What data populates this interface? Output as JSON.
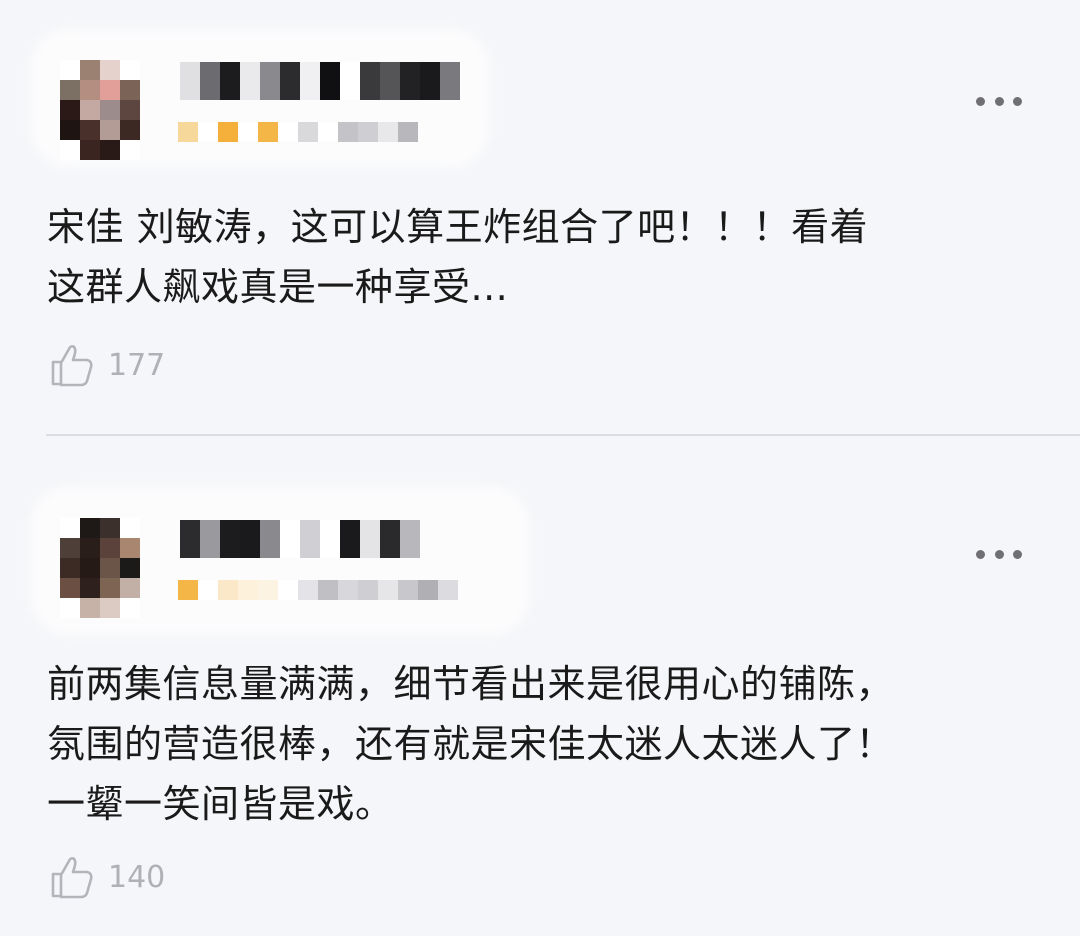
{
  "comments": [
    {
      "text_lines": [
        "宋佳 刘敏涛，这可以算王炸组合了吧！！！看着",
        "这群人飙戏真是一种享受..."
      ],
      "likes": "177",
      "avatar_colors": [
        "#ffffff",
        "#9a8171",
        "#e6d2cc",
        "#ffffff",
        "#7c6f64",
        "#b48e80",
        "#e29e99",
        "#7b6358",
        "#2a1916",
        "#c3a9a2",
        "#9c8c8c",
        "#5c463f",
        "#1e1412",
        "#4a302b",
        "#b39c95",
        "#3c2924",
        "#ffffff",
        "#3a2521",
        "#2a1a17",
        "#ffffff"
      ],
      "name_colors": [
        "#e0e0e3",
        "#6b6b70",
        "#1c1c1e",
        "#eaeaec",
        "#8a8a8e",
        "#2c2c2e",
        "#f0f0f2",
        "#101012",
        "#ffffff",
        "#3a3a3c",
        "#555558",
        "#222224",
        "#1a1a1c",
        "#7a7a7e"
      ],
      "meta_colors": [
        "#f6d89a",
        "#ffffff",
        "#f4b03a",
        "#ffffff",
        "#f5b648",
        "#ffffff",
        "#d9d9dc",
        "#ffffff",
        "#c4c4c8",
        "#cfcfd3",
        "#e8e8ea",
        "#b8b8bc"
      ]
    },
    {
      "text_lines": [
        "前两集信息量满满，细节看出来是很用心的铺陈，",
        "氛围的营造很棒，还有就是宋佳太迷人太迷人了！",
        "一颦一笑间皆是戏。"
      ],
      "likes": "140",
      "avatar_colors": [
        "#ffffff",
        "#1e1816",
        "#3b302c",
        "#ffffff",
        "#4e3f39",
        "#2a1e1b",
        "#5b433b",
        "#a88670",
        "#3c2a24",
        "#261a17",
        "#6b5549",
        "#1c1a18",
        "#6b4f43",
        "#2e211d",
        "#7e6453",
        "#c2b0a6",
        "#ffffff",
        "#c7b2a8",
        "#dccbc3",
        "#ffffff"
      ],
      "name_colors": [
        "#2c2c2e",
        "#9a9a9e",
        "#1c1c1e",
        "#1a1a1c",
        "#8a8a8e",
        "#ffffff",
        "#d0d0d4",
        "#ffffff",
        "#1a1a1c",
        "#e4e4e6",
        "#2a2a2c",
        "#b8b8bc"
      ],
      "meta_colors": [
        "#f5b648",
        "#ffffff",
        "#fbe8c8",
        "#fdf1dc",
        "#fdf3e2",
        "#ffffff",
        "#e4e4e8",
        "#c0c0c4",
        "#d8d8dc",
        "#cfcfd3",
        "#e6e6e8",
        "#c8c8cc",
        "#b0b0b4",
        "#dcdce0"
      ]
    }
  ]
}
